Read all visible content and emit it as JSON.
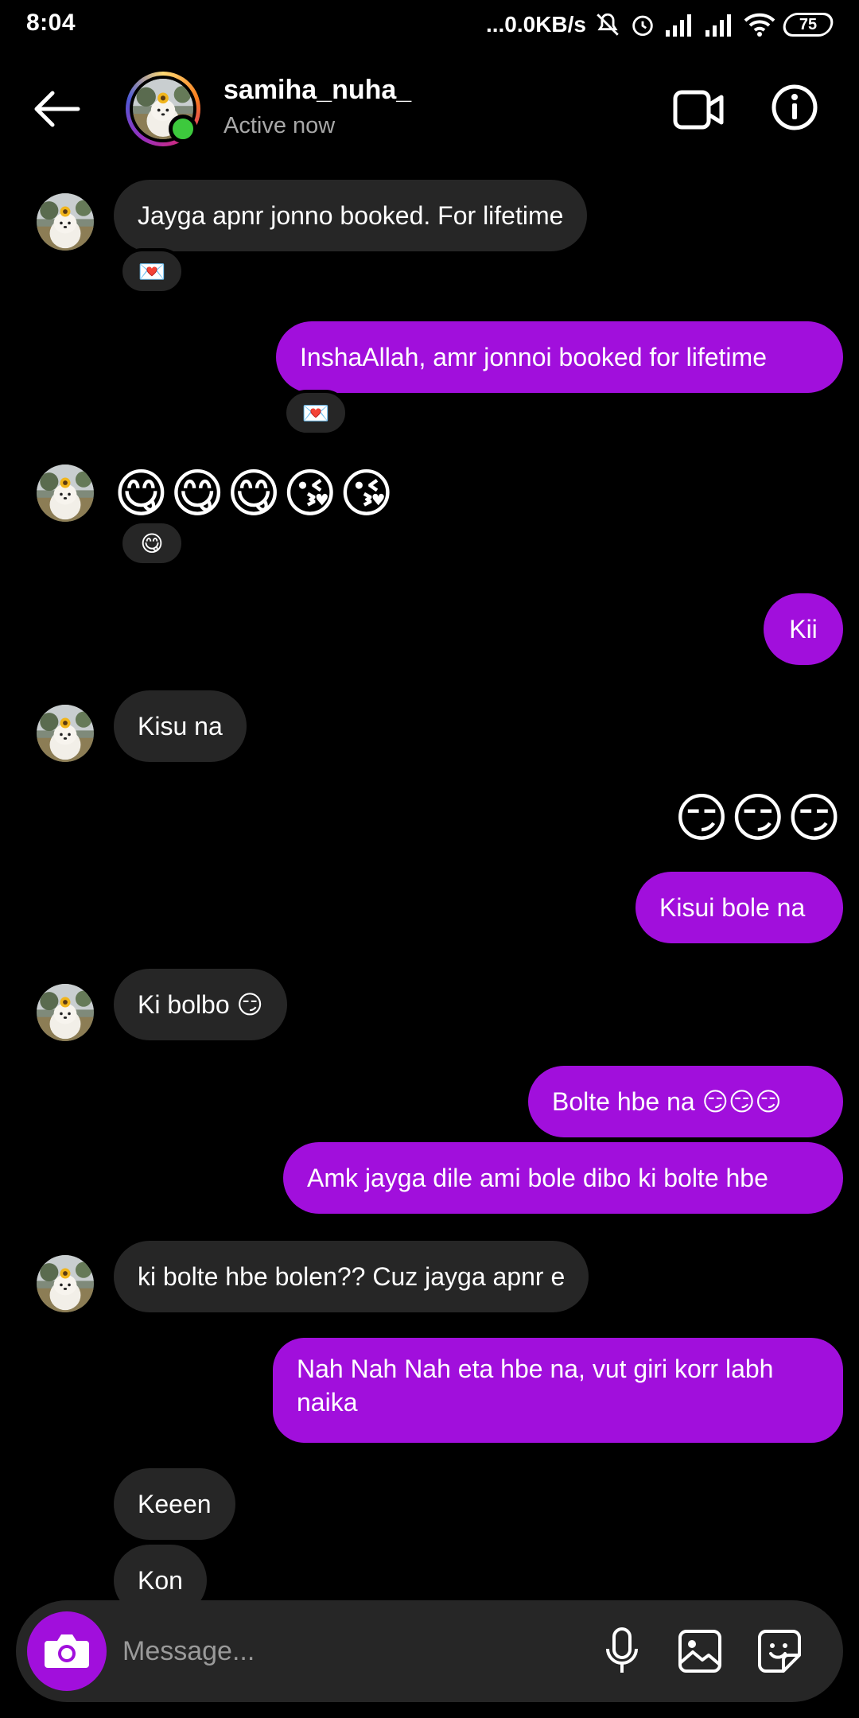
{
  "status_bar": {
    "time": "8:04",
    "network_speed": "...0.0KB/s",
    "battery": "75",
    "icons": [
      "mute-icon",
      "alarm-icon",
      "signal-icon",
      "signal-icon",
      "wifi-icon",
      "battery-icon"
    ]
  },
  "header": {
    "username": "samiha_nuha_",
    "status": "Active now",
    "icons": [
      "back-arrow-icon",
      "video-call-icon",
      "info-icon"
    ],
    "online_color": "#3dc93d"
  },
  "messages": [
    {
      "from": "them",
      "text": "Jayga apnr jonno booked. For lifetime",
      "reaction": "💌"
    },
    {
      "from": "me",
      "text": "InshaAllah, amr jonnoi booked for lifetime",
      "reaction": "💌"
    },
    {
      "from": "them",
      "text": "😋😋😋😘😘",
      "reaction": "😋"
    },
    {
      "from": "me",
      "text": "Kii"
    },
    {
      "from": "them",
      "text": "Kisu na"
    },
    {
      "from": "me",
      "text": "😏😏😏"
    },
    {
      "from": "me",
      "text": "Kisui bole na"
    },
    {
      "from": "them",
      "text": "Ki bolbo 😏"
    },
    {
      "from": "me",
      "text": "Bolte hbe na 😏😏😏"
    },
    {
      "from": "me",
      "text": "Amk jayga dile ami bole dibo ki bolte hbe"
    },
    {
      "from": "them",
      "text": "ki bolte hbe bolen?? Cuz jayga apnr e"
    },
    {
      "from": "me",
      "text": "Nah Nah Nah eta hbe na, vut giri korr labh naika"
    },
    {
      "from": "them",
      "text": "Keeen"
    },
    {
      "from": "them",
      "text": "Kon"
    }
  ],
  "composer": {
    "placeholder": "Message...",
    "icons": [
      "camera-icon",
      "microphone-icon",
      "gallery-icon",
      "sticker-icon"
    ]
  },
  "colors": {
    "outgoing_bubble": "#a10fdc",
    "incoming_bubble": "#262626",
    "background": "#000000"
  }
}
